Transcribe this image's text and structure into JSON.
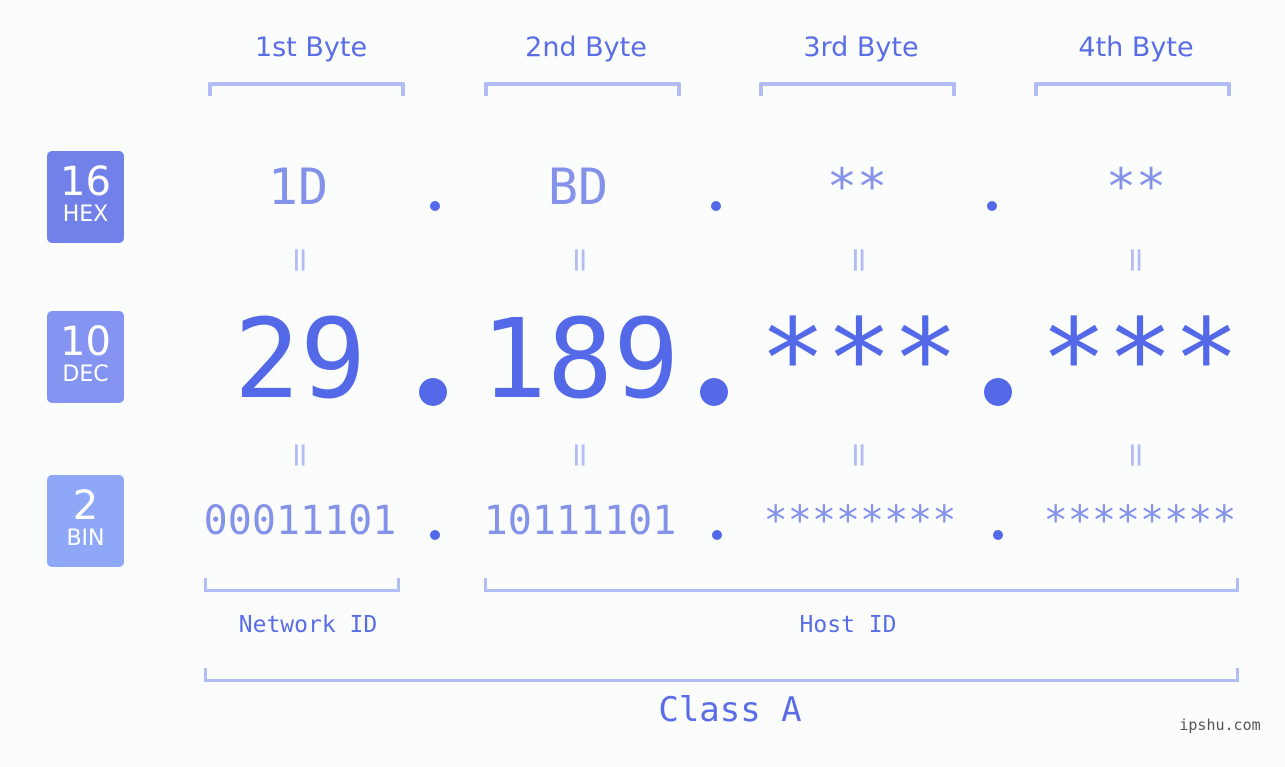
{
  "bytes": [
    {
      "label": "1st Byte",
      "hex": "1D",
      "dec": "29",
      "bin": "00011101"
    },
    {
      "label": "2nd Byte",
      "hex": "BD",
      "dec": "189",
      "bin": "10111101"
    },
    {
      "label": "3rd Byte",
      "hex": "**",
      "dec": "***",
      "bin": "********"
    },
    {
      "label": "4th Byte",
      "hex": "**",
      "dec": "***",
      "bin": "********"
    }
  ],
  "badges": {
    "hex": {
      "num": "16",
      "label": "HEX",
      "color": "#7281ea"
    },
    "dec": {
      "num": "10",
      "label": "DEC",
      "color": "#8494f0"
    },
    "bin": {
      "num": "2",
      "label": "BIN",
      "color": "#8ea7f7"
    }
  },
  "equals_sign": "=",
  "network_id_label": "Network ID",
  "host_id_label": "Host ID",
  "class_label": "Class A",
  "watermark": "ipshu.com",
  "colors": {
    "primary": "#5469e8",
    "secondary": "#8592ea",
    "bracket": "#b3bdf5",
    "background": "#fbfdfc"
  }
}
